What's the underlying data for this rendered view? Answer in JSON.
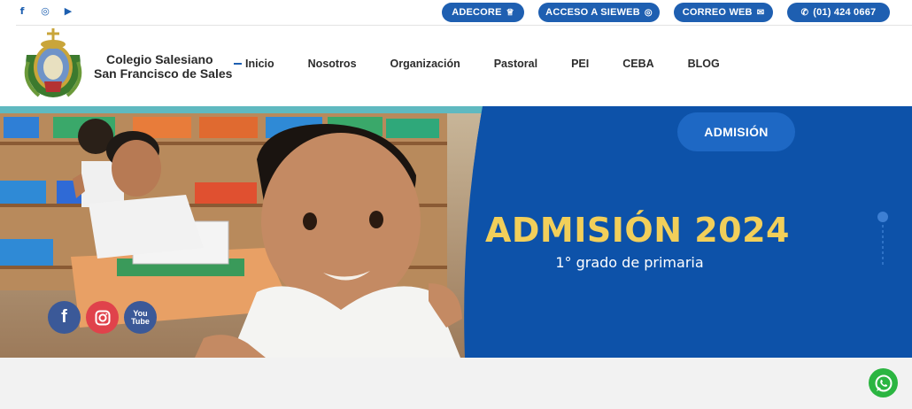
{
  "topbar": {
    "social": [
      {
        "name": "facebook",
        "glyph": "f"
      },
      {
        "name": "instagram",
        "glyph": "◎"
      },
      {
        "name": "youtube",
        "glyph": "▶"
      }
    ],
    "buttons": [
      {
        "label": "ADECORE",
        "icon": "♕"
      },
      {
        "label": "ACCESO A SIEWEB",
        "icon": "◎"
      },
      {
        "label": "CORREO WEB",
        "icon": "✉"
      },
      {
        "label": "(01) 424 0667",
        "icon": "✆"
      }
    ]
  },
  "brand": {
    "line1": "Colegio Salesiano",
    "line2": "San Francisco de Sales"
  },
  "nav": [
    {
      "label": "Inicio",
      "active": true
    },
    {
      "label": "Nosotros"
    },
    {
      "label": "Organización"
    },
    {
      "label": "Pastoral"
    },
    {
      "label": "PEI"
    },
    {
      "label": "CEBA"
    },
    {
      "label": "BLOG"
    }
  ],
  "hero": {
    "cta": "ADMISIÓN",
    "title": "ADMISIÓN 2024",
    "subtitle": "1° grado de primaria"
  },
  "hero_social": [
    {
      "name": "facebook",
      "glyph": "f"
    },
    {
      "name": "instagram",
      "glyph": "◎"
    },
    {
      "name": "youtube",
      "line1": "You",
      "line2": "Tube"
    }
  ],
  "colors": {
    "brand_blue": "#1e5fb1",
    "hero_blue": "#0d52a9",
    "title_yellow": "#f2cf5a",
    "whatsapp_green": "#2bb541"
  }
}
